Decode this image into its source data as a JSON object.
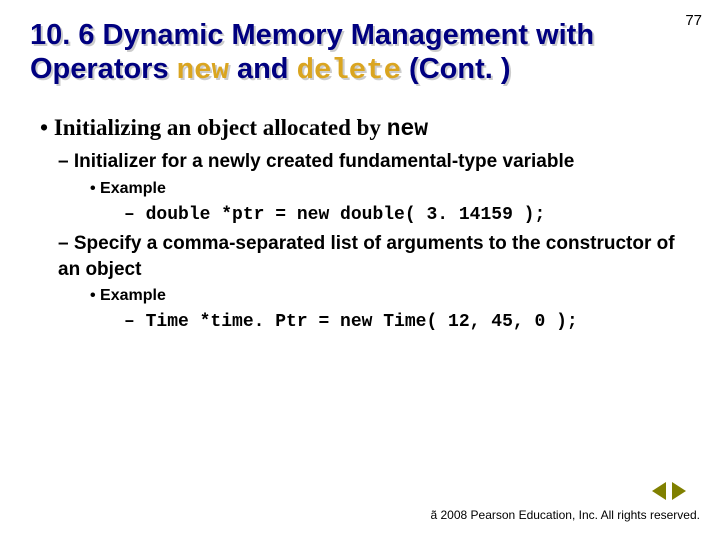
{
  "page_number": "77",
  "title": {
    "prefix": "10. 6 Dynamic Memory Management with Operators ",
    "kw1": "new",
    "mid": " and ",
    "kw2": "delete",
    "suffix": " (Cont. )"
  },
  "b1": {
    "bullet": "• ",
    "text": "Initializing an object allocated by ",
    "kw": "new"
  },
  "b2a": "–  Initializer for a newly created fundamental-type variable",
  "b3a": "•  Example",
  "b4a": {
    "dash": "– ",
    "code": "double *ptr = new double( 3. 14159 );"
  },
  "b2b": "–  Specify a comma-separated list of arguments to the constructor of an object",
  "b3b": "•  Example",
  "b4b": {
    "dash": "– ",
    "code": "Time *time. Ptr = new Time( 12, 45, 0 );"
  },
  "footer": {
    "copy": "ã",
    "text": " 2008 Pearson Education, Inc.  All rights reserved."
  }
}
